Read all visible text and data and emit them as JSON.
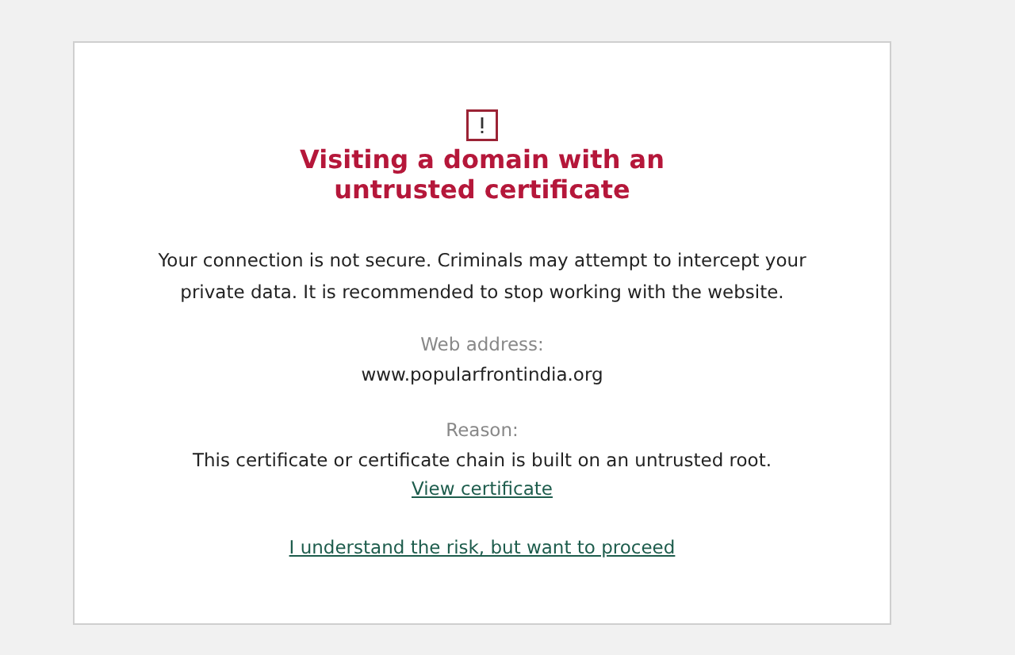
{
  "title": "Visiting a domain with an untrusted certificate",
  "message": "Your connection is not secure. Criminals may attempt to intercept your private data. It is recommended to stop working with the website.",
  "web_address": {
    "label": "Web address:",
    "value": "www.popularfrontindia.org"
  },
  "reason": {
    "label": "Reason:",
    "value": "This certificate or certificate chain is built on an untrusted root.",
    "link": "View certificate"
  },
  "proceed_link": "I understand the risk, but want to proceed"
}
